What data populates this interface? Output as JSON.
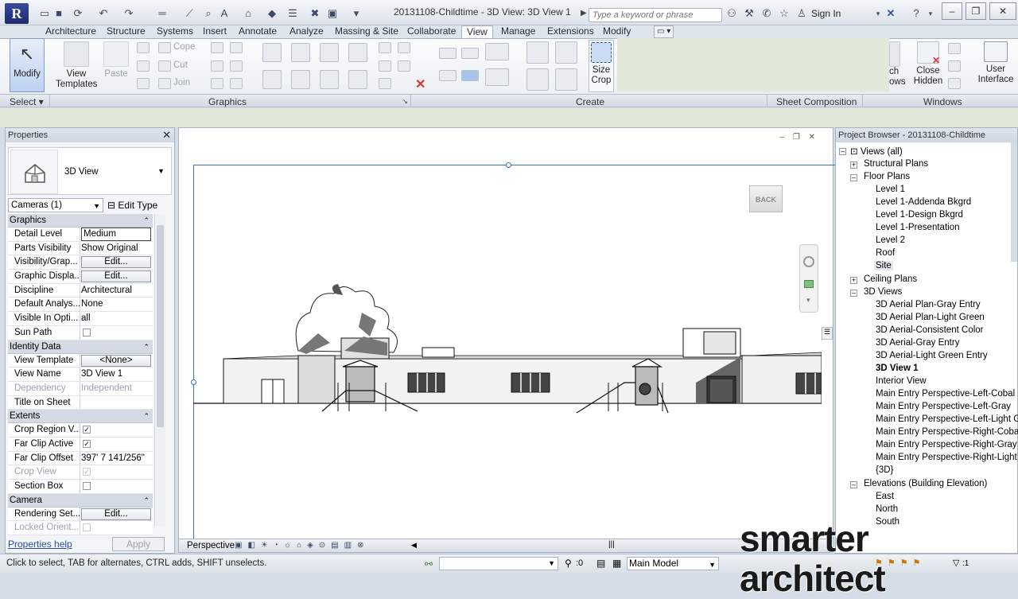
{
  "app": {
    "title": "20131108-Childtime - 3D View: 3D View 1",
    "search_placeholder": "Type a keyword or phrase",
    "sign_in": "Sign In"
  },
  "tabs": [
    "Architecture",
    "Structure",
    "Systems",
    "Insert",
    "Annotate",
    "Analyze",
    "Massing & Site",
    "Collaborate",
    "View",
    "Manage",
    "Extensions",
    "Modify"
  ],
  "active_tab": "View",
  "ribbon": {
    "modify_label": "Modify",
    "view_templates_label": "View Templates",
    "paste_label": "Paste",
    "cope_label": "Cope",
    "cut_label": "Cut",
    "join_label": "Join",
    "size_crop_label": "Size Crop",
    "switch_windows_label": "ch ows",
    "close_hidden_label": "Close Hidden",
    "user_interface_label": "User Interface",
    "panels": {
      "select": "Select",
      "graphics": "Graphics",
      "create": "Create",
      "sheet_composition": "Sheet Composition",
      "windows": "Windows"
    }
  },
  "properties": {
    "title": "Properties",
    "type_name": "3D View",
    "filter": "Cameras (1)",
    "edit_type": "Edit Type",
    "sections": {
      "graphics": "Graphics",
      "identity": "Identity Data",
      "extents": "Extents",
      "camera": "Camera"
    },
    "rows": {
      "detail_level": {
        "name": "Detail Level",
        "value": "Medium"
      },
      "parts_visibility": {
        "name": "Parts Visibility",
        "value": "Show Original"
      },
      "visibility_graphics": {
        "name": "Visibility/Grap...",
        "value": "Edit..."
      },
      "graphic_display": {
        "name": "Graphic Displa...",
        "value": "Edit..."
      },
      "discipline": {
        "name": "Discipline",
        "value": "Architectural"
      },
      "default_analysis": {
        "name": "Default Analys...",
        "value": "None"
      },
      "visible_in_option": {
        "name": "Visible In Opti...",
        "value": "all"
      },
      "sun_path": {
        "name": "Sun Path",
        "checked": false
      },
      "view_template": {
        "name": "View Template",
        "value": "<None>"
      },
      "view_name": {
        "name": "View Name",
        "value": "3D View 1"
      },
      "dependency": {
        "name": "Dependency",
        "value": "Independent"
      },
      "title_on_sheet": {
        "name": "Title on Sheet",
        "value": ""
      },
      "crop_region_visible": {
        "name": "Crop Region V...",
        "checked": true
      },
      "far_clip_active": {
        "name": "Far Clip Active",
        "checked": true
      },
      "far_clip_offset": {
        "name": "Far Clip Offset",
        "value": "397'  7 141/256\""
      },
      "crop_view": {
        "name": "Crop View",
        "checked": true
      },
      "section_box": {
        "name": "Section Box",
        "checked": false
      },
      "rendering_settings": {
        "name": "Rendering Set...",
        "value": "Edit..."
      },
      "locked_orientation": {
        "name": "Locked Orient...",
        "checked": false
      }
    },
    "help": "Properties help",
    "apply": "Apply"
  },
  "view": {
    "viewcube_face": "BACK",
    "visual_style": "Perspective"
  },
  "browser": {
    "title": "Project Browser - 20131108-Childtime",
    "root": "Views (all)",
    "structural_plans": "Structural Plans",
    "floor_plans": "Floor Plans",
    "floor_plan_items": [
      "Level 1",
      "Level 1-Addenda Bkgrd",
      "Level 1-Design Bkgrd",
      "Level 1-Presentation",
      "Level 2",
      "Roof",
      "Site"
    ],
    "ceiling_plans": "Ceiling Plans",
    "views_3d": "3D Views",
    "views_3d_items": [
      "3D Aerial Plan-Gray Entry",
      "3D Aerial Plan-Light Green",
      "3D Aerial-Consistent Color",
      "3D Aerial-Gray Entry",
      "3D Aerial-Light Green Entry",
      "3D View 1",
      "Interior View",
      "Main Entry Perspective-Left-Cobal",
      "Main Entry Perspective-Left-Gray",
      "Main Entry Perspective-Left-Light G",
      "Main Entry Perspective-Right-Cobal",
      "Main Entry Perspective-Right-Gray",
      "Main Entry Perspective-Right-Light",
      "{3D}"
    ],
    "elevations": "Elevations (Building Elevation)",
    "elevation_items": [
      "East",
      "North",
      "South"
    ]
  },
  "status": {
    "hint": "Click to select, TAB for alternates, CTRL adds, SHIFT unselects.",
    "coords": ":0",
    "model": "Main Model",
    "filter_count": ":1"
  },
  "watermark": "smarter architect"
}
